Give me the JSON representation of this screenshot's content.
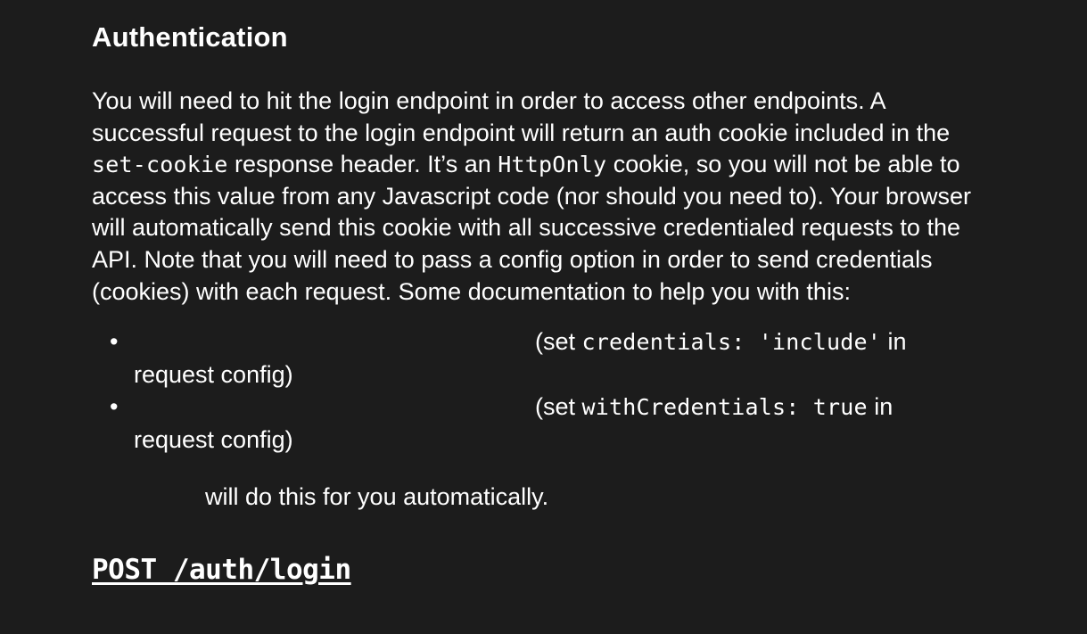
{
  "heading": "Authentication",
  "intro": {
    "part1": "You will need to hit the login endpoint in order to access other endpoints. A successful request to the login endpoint will return an auth cookie included in the ",
    "code1": "set-cookie",
    "part2": " response header. It’s an ",
    "code2": "HttpOnly",
    "part3": " cookie, so you will not be able to access this value from any Javascript code (nor should you need to). Your browser will automatically send this cookie with all successive credentialed requests to the API. Note that you will need to pass a config option in order to send credentials (cookies) with each request. Some documentation to help you with this:"
  },
  "list": [
    {
      "bullet": "•",
      "prefix": "(set ",
      "code": "credentials: 'include'",
      "suffix": " in request config)"
    },
    {
      "bullet": "•",
      "prefix": "(set ",
      "code": "withCredentials: true",
      "suffix": " in request config)"
    }
  ],
  "auto_note": "will do this for you automatically.",
  "endpoint": "POST /auth/login"
}
